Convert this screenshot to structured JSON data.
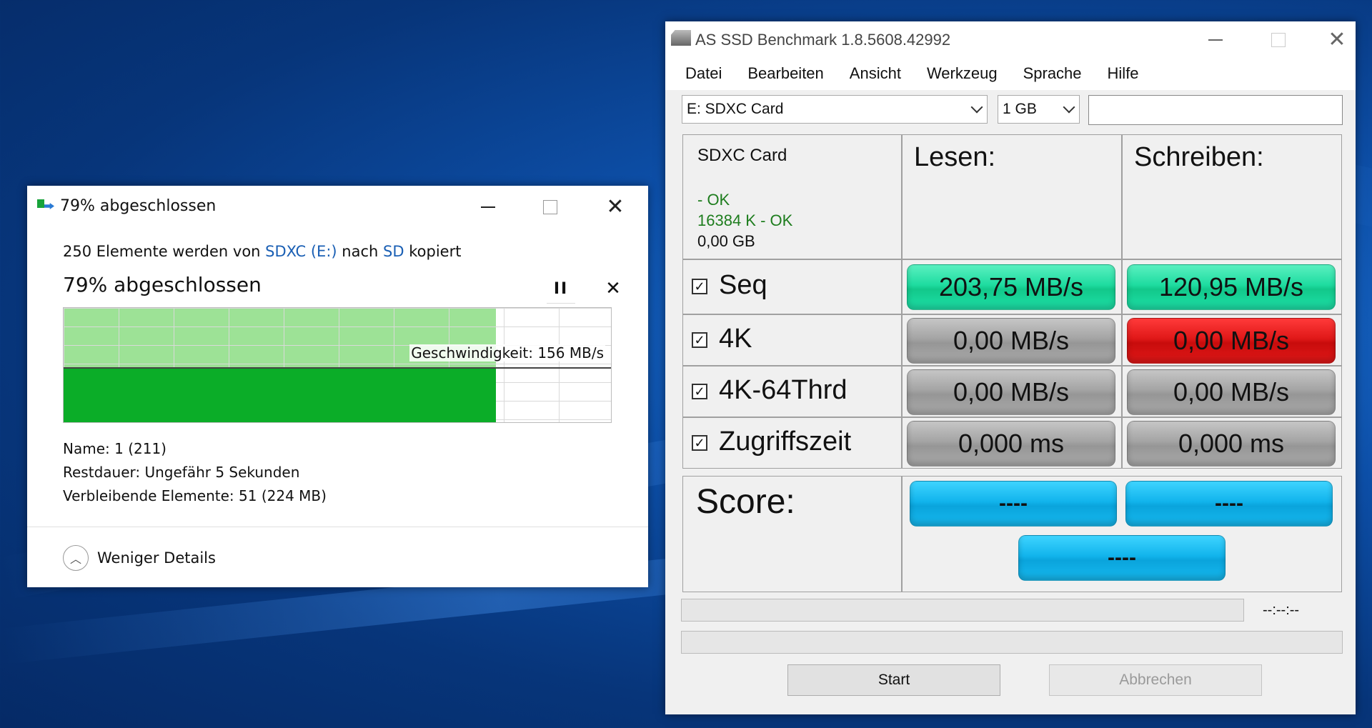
{
  "copy_dialog": {
    "title": "79% abgeschlossen",
    "summary_prefix": "250 Elemente werden von",
    "source": "SDXC (E:)",
    "connector": "nach",
    "destination": "SD",
    "summary_suffix": "kopiert",
    "progress_heading": "79% abgeschlossen",
    "progress_percent": 79,
    "pause_symbol": "II",
    "cancel_symbol": "✕",
    "speed_label": "Geschwindigkeit: 156 MB/s",
    "name_label": "Name:",
    "name_value": "1 (211)",
    "remaining_time_label": "Restdauer:",
    "remaining_time_value": "Ungefähr 5 Sekunden",
    "remaining_items_label": "Verbleibende Elemente:",
    "remaining_items_value": "51 (224 MB)",
    "less_details": "Weniger Details",
    "window_buttons": {
      "minimize": "minimize",
      "maximize": "maximize",
      "close": "✕"
    }
  },
  "ssd": {
    "title": "AS SSD Benchmark 1.8.5608.42992",
    "window_close": "✕",
    "menu": [
      "Datei",
      "Bearbeiten",
      "Ansicht",
      "Werkzeug",
      "Sprache",
      "Hilfe"
    ],
    "drive_select": "E: SDXC Card",
    "size_select": "1 GB",
    "drive_info": {
      "name": "SDXC Card",
      "status1": " - OK",
      "status2": "16384 K - OK",
      "size": "0,00 GB"
    },
    "col_read": "Lesen:",
    "col_write": "Schreiben:",
    "check_mark": "✓",
    "rows": [
      {
        "label": "Seq",
        "read": "203,75 MB/s",
        "write": "120,95 MB/s",
        "read_color": "green",
        "write_color": "green"
      },
      {
        "label": "4K",
        "read": "0,00 MB/s",
        "write": "0,00 MB/s",
        "read_color": "gray",
        "write_color": "red"
      },
      {
        "label": "4K-64Thrd",
        "read": "0,00 MB/s",
        "write": "0,00 MB/s",
        "read_color": "gray",
        "write_color": "gray"
      },
      {
        "label": "Zugriffszeit",
        "read": "0,000 ms",
        "write": "0,000 ms",
        "read_color": "gray",
        "write_color": "gray"
      }
    ],
    "score_label": "Score:",
    "score_read": "----",
    "score_write": "----",
    "score_total": "----",
    "time_display": "--:--:--",
    "start_button": "Start",
    "abort_button": "Abbrechen"
  },
  "colors": {
    "green_result": "#1edca0",
    "red_result": "#e01818",
    "gray_result": "#a4a4a4",
    "score_blue": "#12b4ec",
    "copy_graph_dark": "#0bad28",
    "copy_graph_light": "#74d66a",
    "link_blue": "#1a5fb4"
  }
}
